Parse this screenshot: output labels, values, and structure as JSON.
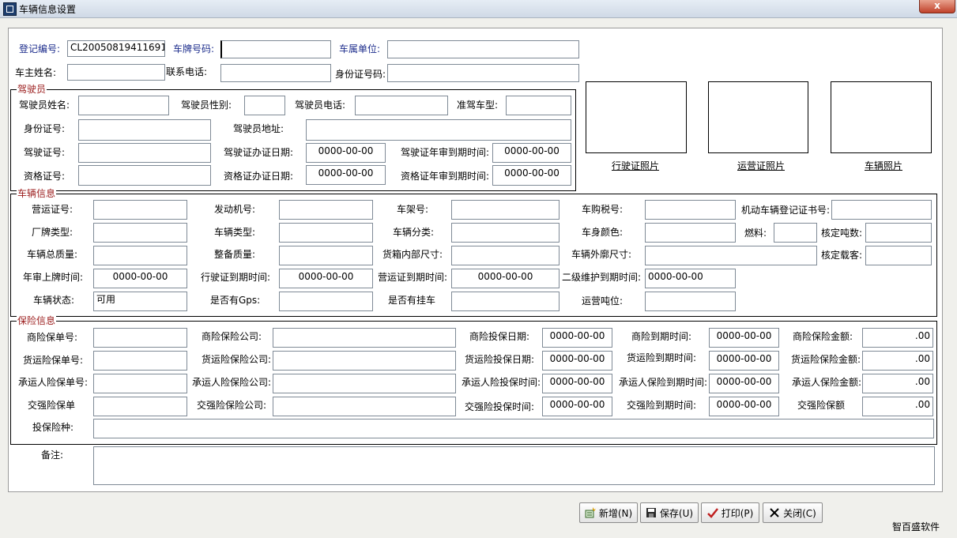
{
  "window": {
    "title": "车辆信息设置",
    "close_label": "x"
  },
  "top": {
    "reg_no_label": "登记编号:",
    "reg_no": "CL20050819411691",
    "plate_label": "车牌号码:",
    "plate": "",
    "owner_unit_label": "车属单位:",
    "owner_unit": "",
    "owner_name_label": "车主姓名:",
    "owner_name": "",
    "phone_label": "联系电话:",
    "phone": "",
    "id_label": "身份证号码:",
    "id": ""
  },
  "driver": {
    "title": "驾驶员",
    "name_label": "驾驶员姓名:",
    "sex_label": "驾驶员性别:",
    "phone_label": "驾驶员电话:",
    "class_label": "准驾车型:",
    "id_label": "身份证号:",
    "addr_label": "驾驶员地址:",
    "license_label": "驾驶证号:",
    "license_date_label": "驾驶证办证日期:",
    "license_date": "0000-00-00",
    "license_exp_label": "驾驶证年审到期时间:",
    "license_exp": "0000-00-00",
    "qual_label": "资格证号:",
    "qual_date_label": "资格证办证日期:",
    "qual_date": "0000-00-00",
    "qual_exp_label": "资格证年审到期时间:",
    "qual_exp": "0000-00-00"
  },
  "photos": [
    {
      "label": "行驶证照片"
    },
    {
      "label": "运营证照片"
    },
    {
      "label": "车辆照片"
    }
  ],
  "vehicle": {
    "title": "车辆信息",
    "op_cert_label": "营运证号:",
    "engine_label": "发动机号:",
    "frame_label": "车架号:",
    "tax_label": "车购税号:",
    "reg_cert_label": "机动车辆登记证书号:",
    "brand_label": "厂牌类型:",
    "type_label": "车辆类型:",
    "class_label": "车辆分类:",
    "color_label": "车身颜色:",
    "fuel_label": "燃料:",
    "tonnage_label": "核定吨数:",
    "gross_label": "车辆总质量:",
    "curb_label": "整备质量:",
    "inner_label": "货箱内部尺寸:",
    "outer_label": "车辆外廓尺寸:",
    "seats_label": "核定载客:",
    "annual_label": "年审上牌时间:",
    "annual": "0000-00-00",
    "drive_exp_label": "行驶证到期时间:",
    "drive_exp": "0000-00-00",
    "op_exp_label": "营运证到期时间:",
    "op_exp": "0000-00-00",
    "maint_label": "二级维护到期时间:",
    "maint": "0000-00-00",
    "status_label": "车辆状态:",
    "status": "可用",
    "gps_label": "是否有Gps:",
    "trailer_label": "是否有挂车",
    "op_tonnage_label": "运营吨位:"
  },
  "insurance": {
    "title": "保险信息",
    "rows": [
      {
        "no_label": "商险保单号:",
        "co_label": "商险保险公司:",
        "date_label": "商险投保日期:",
        "date": "0000-00-00",
        "exp_label": "商险到期时间:",
        "exp": "0000-00-00",
        "amt_label": "商险保险金额:",
        "amt": ".00"
      },
      {
        "no_label": "货运险保单号:",
        "co_label": "货运险保险公司:",
        "date_label": "货运险投保日期:",
        "date": "0000-00-00",
        "exp_label": "货运险到期时间:",
        "exp": "0000-00-00",
        "amt_label": "货运险保险金额:",
        "amt": ".00"
      },
      {
        "no_label": "承运人险保单号:",
        "co_label": "承运人险保险公司:",
        "date_label": "承运人险投保时间:",
        "date": "0000-00-00",
        "exp_label": "承运人保险到期时间:",
        "exp": "0000-00-00",
        "amt_label": "承运人保险金额:",
        "amt": ".00"
      },
      {
        "no_label": "交强险保单",
        "co_label": "交强险保险公司:",
        "date_label": "交强险投保时间:",
        "date": "0000-00-00",
        "exp_label": "交强险到期时间:",
        "exp": "0000-00-00",
        "amt_label": "交强险保额",
        "amt": ".00"
      }
    ],
    "kind_label": "投保险种:"
  },
  "remark_label": "备注:",
  "buttons": {
    "add": "新增(N)",
    "save": "保存(U)",
    "print": "打印(P)",
    "close": "关闭(C)"
  },
  "brand": "智百盛软件"
}
